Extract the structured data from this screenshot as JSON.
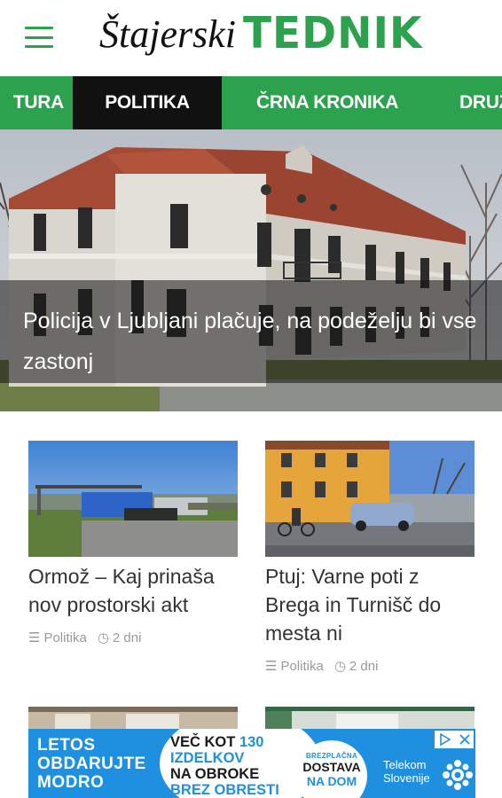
{
  "header": {
    "logo_script": "Štajerski",
    "logo_bold": "TEDNIK"
  },
  "nav": {
    "items": [
      {
        "label": "TURA"
      },
      {
        "label": "POLITIKA"
      },
      {
        "label": "ČRNA KRONIKA"
      },
      {
        "label": "DRUŽ"
      }
    ],
    "active_index": 1
  },
  "hero": {
    "title": "Policija v Ljubljani plačuje, na podeželju bi vse zastonj"
  },
  "articles": [
    {
      "title": "Ormož – Kaj prinaša nov prostorski akt",
      "category": "Politika",
      "time": "2 dni"
    },
    {
      "title": "Ptuj: Varne poti z Brega in Turnišč do mesta ni",
      "category": "Politika",
      "time": "2 dni"
    }
  ],
  "ad": {
    "left_text": [
      "LETOS",
      "OBDARUJTE",
      "MODRO"
    ],
    "mid_line1": "VEČ KOT",
    "mid_number": "130",
    "mid_line2": "IZDELKOV",
    "mid_line3": "NA OBROKE",
    "mid_line4": "BREZ OBRESTI",
    "circle_small": "BREZPLAČNA",
    "circle_line1": "DOSTAVA",
    "circle_line2": "NA DOM",
    "brand_line1": "Telekom",
    "brand_line2": "Slovenije"
  },
  "colors": {
    "brand_green": "#2ca24e",
    "nav_active": "#111111",
    "ad_blue": "#1f8fe0",
    "meta_gray": "#9a9a9a"
  }
}
